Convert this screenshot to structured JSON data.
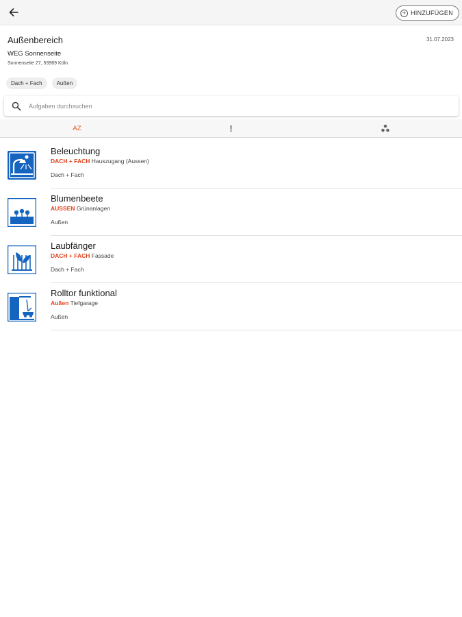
{
  "topbar": {
    "add_label": "HINZUFÜGEN"
  },
  "header": {
    "title": "Außenbereich",
    "date": "31.07.2023",
    "property_name": "WEG Sonnenseite",
    "property_address": "Sonnenseite 27, 53969 Köln",
    "chips": [
      "Dach + Fach",
      "Außen"
    ]
  },
  "search": {
    "placeholder": "Aufgaben durchsuchen"
  },
  "sort": {
    "az_label": "AZ",
    "priority_label": "!"
  },
  "colors": {
    "accent": "#e0421b",
    "icon_blue": "#1565c0"
  },
  "tasks": [
    {
      "name": "Beleuchtung",
      "tag": "DACH + FACH",
      "location": "Hauszugang (Aussen)",
      "group": "Dach + Fach",
      "icon": "light-icon"
    },
    {
      "name": "Blumenbeete",
      "tag": "AUSSEN",
      "location": "Grünanlagen",
      "group": "Außen",
      "icon": "flowerbed-icon"
    },
    {
      "name": "Laubfänger",
      "tag": "DACH + FACH",
      "location": "Fassade",
      "group": "Dach + Fach",
      "icon": "leaf-guard-icon"
    },
    {
      "name": "Rolltor funktional",
      "tag": "Außen",
      "location": "Tiefgarage",
      "group": "Außen",
      "icon": "rolling-gate-icon"
    }
  ]
}
